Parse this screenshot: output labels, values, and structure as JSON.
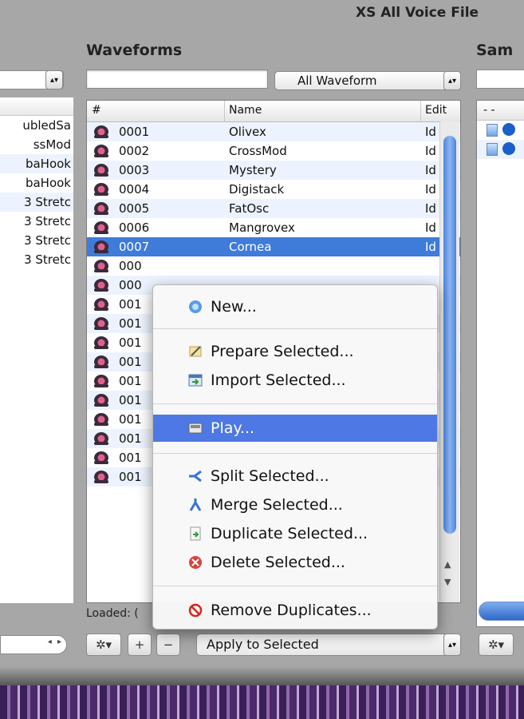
{
  "window": {
    "title": "XS All Voice File"
  },
  "left_panel": {
    "rows": [
      "ubledSa",
      "ssMod",
      "baHook",
      "baHook",
      "3 Stretc",
      "3 Stretc",
      "3 Stretc",
      "3 Stretc"
    ]
  },
  "waveforms": {
    "title": "Waveforms",
    "search_value": "",
    "filter": "All Waveform",
    "columns": {
      "num": "#",
      "name": "Name",
      "edit": "Edit"
    },
    "rows": [
      {
        "num": "0001",
        "name": "Olivex",
        "edit": "Id"
      },
      {
        "num": "0002",
        "name": "CrossMod",
        "edit": "Id"
      },
      {
        "num": "0003",
        "name": "Mystery",
        "edit": "Id"
      },
      {
        "num": "0004",
        "name": "Digistack",
        "edit": "Id"
      },
      {
        "num": "0005",
        "name": "FatOsc",
        "edit": "Id"
      },
      {
        "num": "0006",
        "name": "Mangrovex",
        "edit": "Id"
      },
      {
        "num": "0007",
        "name": "Cornea",
        "edit": "Id"
      },
      {
        "num": "000",
        "name": "",
        "edit": ""
      },
      {
        "num": "000",
        "name": "",
        "edit": ""
      },
      {
        "num": "001",
        "name": "",
        "edit": ""
      },
      {
        "num": "001",
        "name": "",
        "edit": ""
      },
      {
        "num": "001",
        "name": "",
        "edit": ""
      },
      {
        "num": "001",
        "name": "",
        "edit": ""
      },
      {
        "num": "001",
        "name": "",
        "edit": ""
      },
      {
        "num": "001",
        "name": "",
        "edit": ""
      },
      {
        "num": "001",
        "name": "",
        "edit": ""
      },
      {
        "num": "001",
        "name": "",
        "edit": ""
      },
      {
        "num": "001",
        "name": "",
        "edit": ""
      },
      {
        "num": "001",
        "name": "",
        "edit": ""
      }
    ],
    "selected_index": 6,
    "loaded_label": "Loaded: (",
    "add_label": "+",
    "remove_label": "−",
    "apply_select": "Apply to Selected"
  },
  "samples": {
    "title": "Sam",
    "header": "- -"
  },
  "context_menu": {
    "items": [
      {
        "label": "New...",
        "icon": "new-icon"
      },
      {
        "label": "Prepare Selected...",
        "icon": "prepare-icon"
      },
      {
        "label": "Import Selected...",
        "icon": "import-icon"
      },
      {
        "label": "Play...",
        "icon": "play-icon"
      },
      {
        "label": "Split Selected...",
        "icon": "split-icon"
      },
      {
        "label": "Merge Selected...",
        "icon": "merge-icon"
      },
      {
        "label": "Duplicate Selected...",
        "icon": "duplicate-icon"
      },
      {
        "label": "Delete Selected...",
        "icon": "delete-icon"
      },
      {
        "label": "Remove Duplicates...",
        "icon": "remove-duplicates-icon"
      }
    ],
    "highlighted": "Play..."
  },
  "colors": {
    "selection": "#3f7bd8",
    "menu_highlight": "#4e78e3",
    "row_alt": "#edf3fe"
  }
}
